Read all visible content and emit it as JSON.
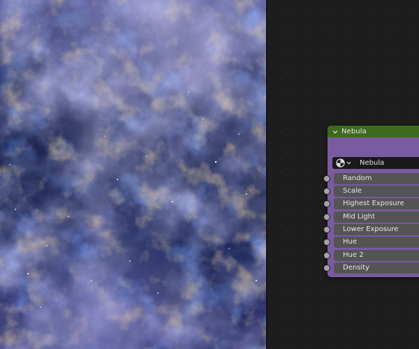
{
  "node": {
    "title": "Nebula",
    "header_color": "#3e6a1f",
    "body_color": "#7a5ba1",
    "group_selector": {
      "name": "Nebula"
    },
    "inputs": [
      {
        "label": "Random"
      },
      {
        "label": "Scale"
      },
      {
        "label": "Highest Exposure"
      },
      {
        "label": "Mid Light"
      },
      {
        "label": "Lower Exposure"
      },
      {
        "label": "Hue"
      },
      {
        "label": "Hue 2"
      },
      {
        "label": "Density"
      }
    ]
  },
  "icons": {
    "collapse": "chevron-down-icon",
    "group": "node-group-icon",
    "dropdown": "chevron-down-icon",
    "socket": "socket-dot"
  }
}
